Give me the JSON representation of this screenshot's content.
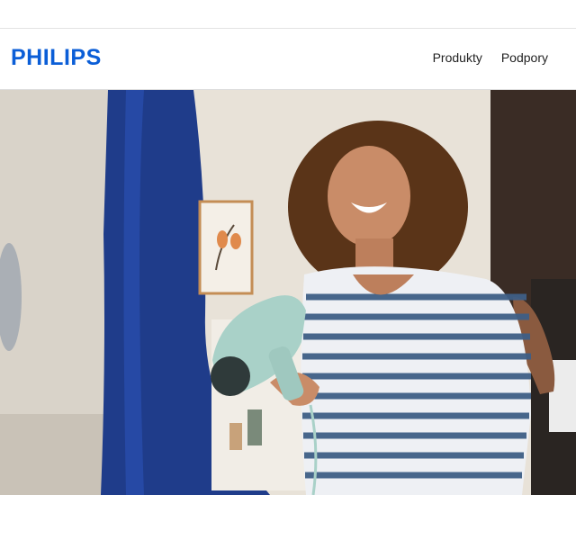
{
  "brand": {
    "logo_text": "PHILIPS",
    "color": "#0b5ed7"
  },
  "nav": {
    "items": [
      {
        "label": "Produkty"
      },
      {
        "label": "Podpory"
      }
    ]
  },
  "hero": {
    "description_icon": "photo-woman-hair-dryer",
    "colors": {
      "wall": "#e8e2d8",
      "curtain": "#1f3c8a",
      "dryer": "#a9d1c8",
      "shirt_stripe": "#3f5f86"
    }
  }
}
